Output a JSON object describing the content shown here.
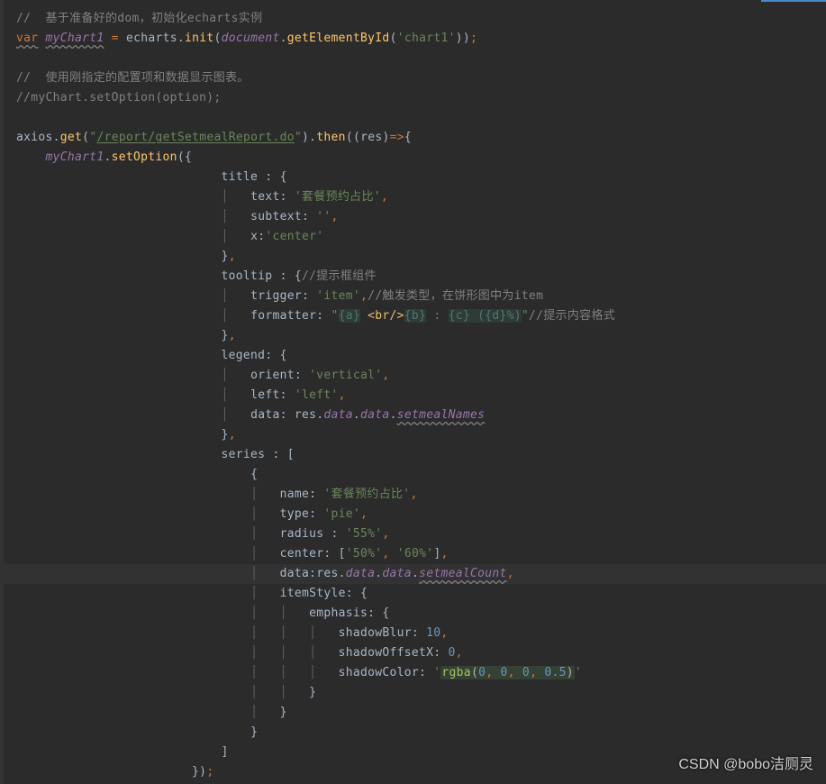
{
  "comments": {
    "c1": "//  基于准备好的dom，初始化echarts实例",
    "c2": "//  使用刚指定的配置项和数据显示图表。",
    "c3": "//myChart.setOption(option);",
    "c4": "//提示框组件",
    "c5": "//触发类型，在饼形图中为item",
    "c6": "//提示内容格式"
  },
  "kw": {
    "var": "var",
    "op_eq": " = ",
    "dot": ".",
    "comma": ",",
    "semi": ";",
    "lp": "(",
    "rp": ")",
    "lb": "{",
    "rb": "}",
    "ls": "[",
    "rs": "]",
    "arrow": "=>",
    "colon": ":"
  },
  "ids": {
    "myChart1": "myChart1",
    "echarts": "echarts",
    "init": "init",
    "document": "document",
    "getElementById": "getElementById",
    "axios": "axios",
    "get": "get",
    "then": "then",
    "res": "res",
    "setOption": "setOption",
    "title": "title",
    "text": "text",
    "subtext": "subtext",
    "x": "x",
    "tooltip": "tooltip",
    "trigger": "trigger",
    "formatter": "formatter",
    "legend": "legend",
    "orient": "orient",
    "left": "left",
    "data": "data",
    "setmealNames": "setmealNames",
    "series": "series",
    "name": "name",
    "type": "type",
    "radius": "radius",
    "center": "center",
    "setmealCount": "setmealCount",
    "itemStyle": "itemStyle",
    "emphasis": "emphasis",
    "shadowBlur": "shadowBlur",
    "shadowOffsetX": "shadowOffsetX",
    "shadowColor": "shadowColor"
  },
  "str": {
    "chart1": "'chart1'",
    "reportUrl": "/report/getSetmealReport.do",
    "titleText": "'套餐预约占比'",
    "empty": "''",
    "centerS": "'center'",
    "item": "'item'",
    "fmt_q": "\"",
    "fmt_a": "{a}",
    "fmt_br": "<br/>",
    "fmt_b": "{b}",
    "fmt_mid": " : ",
    "fmt_c": "{c}",
    "fmt_d": " ({d}%)",
    "vertical": "'vertical'",
    "leftS": "'left'",
    "pie": "'pie'",
    "r55": "'55%'",
    "p50": "'50%'",
    "p60": "'60%'",
    "sq": "'",
    "rgba_pre": "rgba",
    "rgba_lp": "(",
    "rgba_rp": ")"
  },
  "num": {
    "ten": "10",
    "zero": "0",
    "zero2": "0",
    "zero3": "0",
    "zero4": "0",
    "half": "0.5"
  },
  "watermark": "CSDN @bobo洁厕灵"
}
